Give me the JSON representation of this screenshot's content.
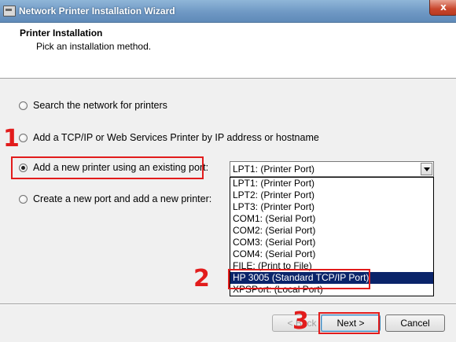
{
  "window": {
    "title": "Network Printer Installation Wizard",
    "close_glyph": "x"
  },
  "header": {
    "title": "Printer Installation",
    "subtitle": "Pick an installation method."
  },
  "options": [
    {
      "label": "Search the network for printers",
      "checked": false
    },
    {
      "label": "Add a TCP/IP or Web Services Printer by IP address or hostname",
      "checked": false
    },
    {
      "label": "Add a new printer using an existing port:",
      "checked": true
    },
    {
      "label": "Create a new port and add a new printer:",
      "checked": false
    }
  ],
  "port_select": {
    "value": "LPT1: (Printer Port)",
    "items": [
      "LPT1: (Printer Port)",
      "LPT2: (Printer Port)",
      "LPT3: (Printer Port)",
      "COM1: (Serial Port)",
      "COM2: (Serial Port)",
      "COM3: (Serial Port)",
      "COM4: (Serial Port)",
      "FILE: (Print to File)",
      "HP 3005 (Standard TCP/IP Port)",
      "XPSPort: (Local Port)"
    ],
    "selected_index": 8
  },
  "annotations": {
    "step1": "1",
    "step2": "2",
    "step3": "3",
    "color": "#e21c1c"
  },
  "buttons": {
    "back": "< Back",
    "next": "Next >",
    "cancel": "Cancel"
  }
}
